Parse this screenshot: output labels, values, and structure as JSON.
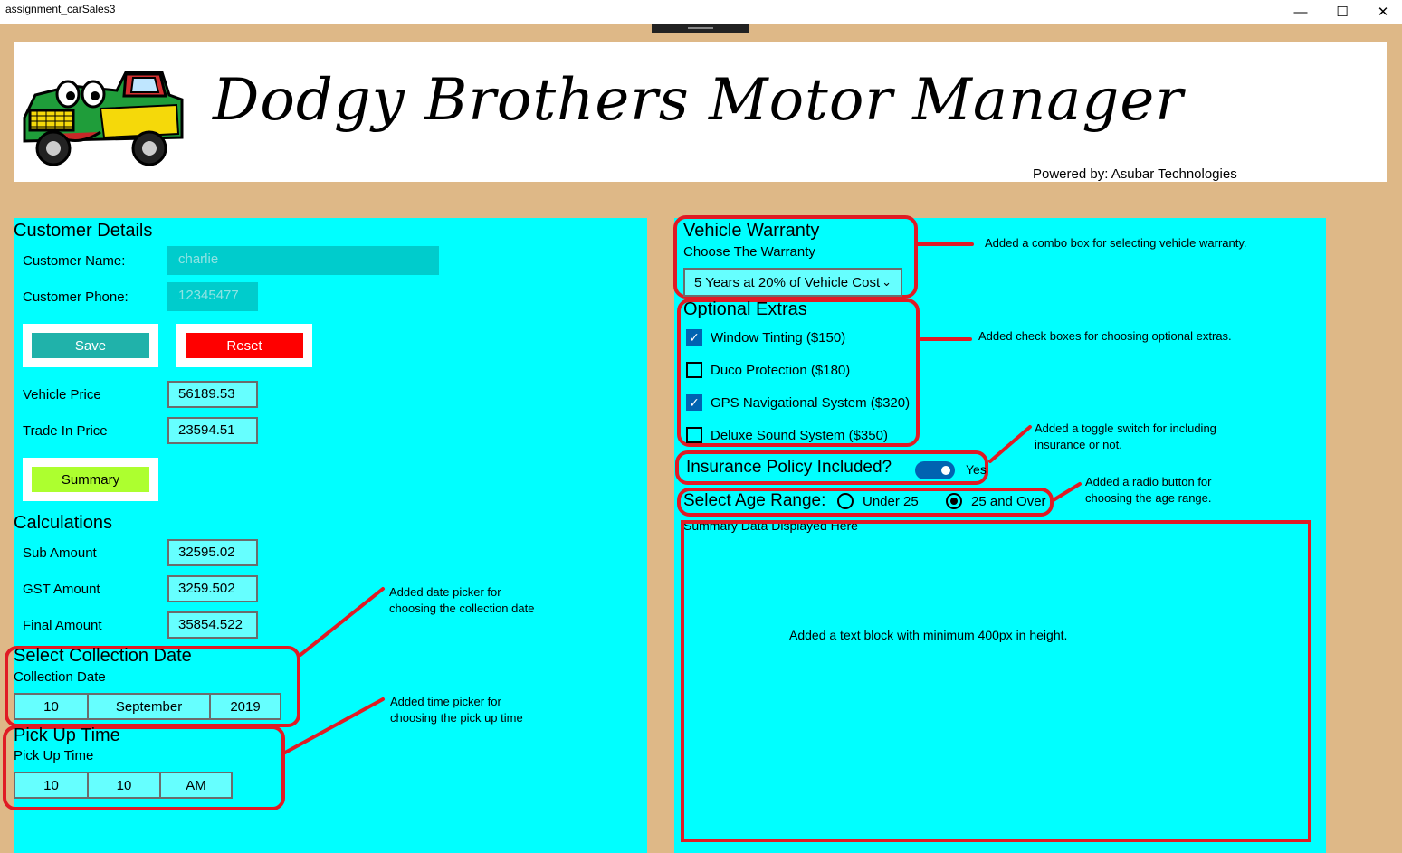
{
  "window": {
    "title": "assignment_carSales3",
    "minimize_icon": "minimize-icon",
    "maximize_icon": "maximize-icon",
    "close_icon": "close-icon"
  },
  "header": {
    "app_title": "Dodgy Brothers Motor Manager",
    "powered_by": "Powered by: Asubar Technologies",
    "logo": "cartoon-pickup-truck-logo"
  },
  "customer": {
    "section_title": "Customer Details",
    "name_label": "Customer Name:",
    "name_value": "charlie",
    "phone_label": "Customer Phone:",
    "phone_value": "12345477",
    "save_label": "Save",
    "reset_label": "Reset",
    "vehicle_price_label": "Vehicle Price",
    "vehicle_price_value": "56189.53",
    "trade_in_label": "Trade In Price",
    "trade_in_value": "23594.51",
    "summary_label": "Summary"
  },
  "calculations": {
    "section_title": "Calculations",
    "sub_label": "Sub Amount",
    "sub_value": "32595.02",
    "gst_label": "GST Amount",
    "gst_value": "3259.502",
    "final_label": "Final Amount",
    "final_value": "35854.522"
  },
  "collection": {
    "section_title": "Select Collection Date",
    "field_label": "Collection Date",
    "day": "10",
    "month": "September",
    "year": "2019"
  },
  "pickup": {
    "section_title": "Pick Up Time",
    "field_label": "Pick Up Time",
    "hour": "10",
    "minute": "10",
    "period": "AM"
  },
  "warranty": {
    "section_title": "Vehicle Warranty",
    "field_label": "Choose The Warranty",
    "selected": "5 Years at 20% of Vehicle Cost"
  },
  "extras": {
    "section_title": "Optional Extras",
    "items": [
      {
        "label": "Window Tinting ($150)",
        "checked": true
      },
      {
        "label": "Duco Protection ($180)",
        "checked": false
      },
      {
        "label": "GPS Navigational System ($320)",
        "checked": true
      },
      {
        "label": "Deluxe Sound System ($350)",
        "checked": false
      }
    ]
  },
  "insurance": {
    "label": "Insurance Policy Included?",
    "state_text": "Yes",
    "on": true
  },
  "age": {
    "label": "Select Age Range:",
    "options": [
      {
        "label": "Under 25",
        "selected": false
      },
      {
        "label": "25 and Over",
        "selected": true
      }
    ]
  },
  "summary_area": {
    "caption": "Summary Data Displayed Here",
    "note": "Added a text block with minimum 400px in height."
  },
  "annotations": {
    "warranty": "Added a combo box for selecting vehicle warranty.",
    "extras": "Added check boxes for choosing optional extras.",
    "toggle_line1": "Added a toggle switch for including",
    "toggle_line2": "insurance or not.",
    "radio_line1": "Added a radio button for",
    "radio_line2": "choosing the age range.",
    "date_line1": "Added date picker for",
    "date_line2": "choosing the collection date",
    "time_line1": "Added time picker for",
    "time_line2": "choosing the pick up time"
  },
  "colors": {
    "panel": "#00ffff",
    "background": "#deb887",
    "save_button": "#20b2aa",
    "reset_button": "#ff0000",
    "summary_button": "#adff2f",
    "annotation_red": "#e01b24",
    "toggle_blue": "#0063b1"
  }
}
